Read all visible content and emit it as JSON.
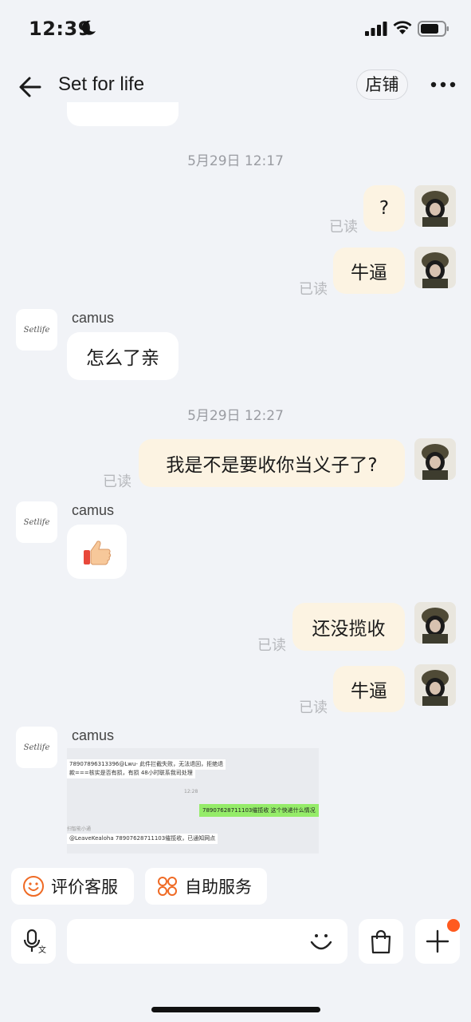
{
  "status_bar": {
    "time": "12:39"
  },
  "header": {
    "title": "Set for life",
    "shop_label": "店铺"
  },
  "messages": {
    "ts1": "5月29日 12:17",
    "m1_text": "?",
    "m2_text": "牛逼",
    "shop_sender_1": "camus",
    "shop_msg_1": "怎么了亲",
    "ts2": "5月29日 12:27",
    "m3_text": "我是不是要收你当义子了?",
    "shop_sender_2": "camus",
    "shop_emoji": "👍",
    "m4_text": "还没揽收",
    "m5_text": "牛逼",
    "shop_sender_3": "camus",
    "read_label": "已读",
    "shop_avatar_text": "Setlife"
  },
  "screenshot": {
    "line1": "78907896313396@Lwu- 此件拦截失败，无法退回，拒绝退",
    "line2": "款===核实是否有损，有损 48小时联系我司处理",
    "time": "12:28",
    "green": "78907628711103催揽收 这个快递什么情况",
    "label": "扫智能小通",
    "line3": "@LeaveKealoha 78907628711103催揽收，已通知网点"
  },
  "actions": {
    "rate_label": "评价客服",
    "self_service_label": "自助服务"
  },
  "input": {
    "value": "",
    "placeholder": ""
  },
  "colors": {
    "accent": "#ff5a1f",
    "my_bubble": "#fcf3e2",
    "background": "#f1f3f7"
  }
}
